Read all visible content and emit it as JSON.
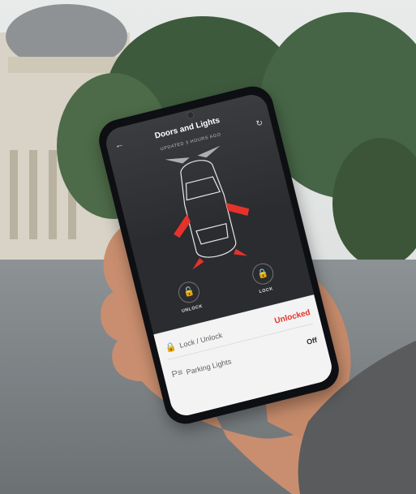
{
  "screen": {
    "title": "Doors and Lights",
    "back_icon": "arrow-left-icon",
    "updated_text": "UPDATED 3 HOURS AGO",
    "refresh_icon": "refresh-icon"
  },
  "controls": {
    "unlock_label": "UNLOCK",
    "lock_label": "LOCK",
    "unlock_color": "#e5322d",
    "lock_color": "#39b54a"
  },
  "settings": [
    {
      "label": "Lock / Unlock",
      "value": "Unlocked",
      "icon": "padlock-icon"
    },
    {
      "label": "Parking Lights",
      "value": "Off",
      "icon": "parking-lights-icon"
    }
  ],
  "colors": {
    "accent_red": "#e5322d",
    "screen_bg": "#2b2d30"
  }
}
